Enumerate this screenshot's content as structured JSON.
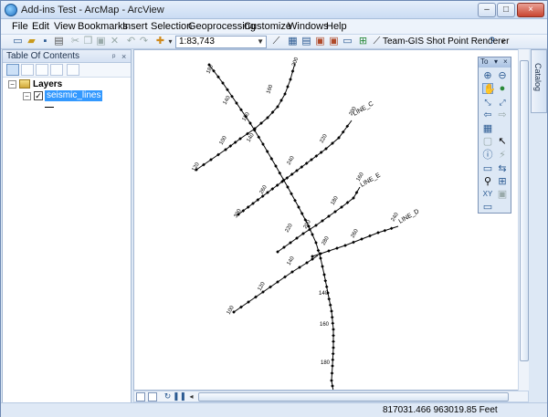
{
  "window": {
    "title": "Add-ins Test - ArcMap - ArcView",
    "minimize": "–",
    "maximize": "□",
    "close": "×"
  },
  "menu": [
    "File",
    "Edit",
    "View",
    "Bookmarks",
    "Insert",
    "Selection",
    "Geoprocessing",
    "Customize",
    "Windows",
    "Help"
  ],
  "toolbar": {
    "scale": "1:83,743",
    "renderer_label": "Team-GIS Shot Point Renderer"
  },
  "toc": {
    "title": "Table Of Contents",
    "pin": "ᵖ",
    "close": "×",
    "root_label": "Layers",
    "layer_name": "seismic_lines",
    "checked": true
  },
  "tools_palette": {
    "title": "To",
    "close": "×"
  },
  "catalog_tab": "Catalog",
  "status": {
    "coordinates": "817031.466  963019.85 Feet"
  },
  "map": {
    "line_labels": [
      "LINE_C",
      "LINE_E",
      "LINE_D"
    ],
    "shot_labels": [
      "200",
      "180",
      "160",
      "140",
      "120",
      "100",
      "120",
      "140",
      "160",
      "180",
      "200",
      "220",
      "240",
      "260",
      "280",
      "300",
      "140",
      "160",
      "180",
      "200",
      "220",
      "240",
      "260",
      "280",
      "100",
      "120",
      "140",
      "160",
      "180",
      "200",
      "220",
      "240",
      "260",
      "280",
      "300",
      "320",
      "340",
      "360",
      "100",
      "120",
      "140",
      "160",
      "180",
      "200",
      "220"
    ]
  },
  "colors": {
    "selection": "#3399ff",
    "frame": "#dde8f5",
    "line": "#000000"
  }
}
